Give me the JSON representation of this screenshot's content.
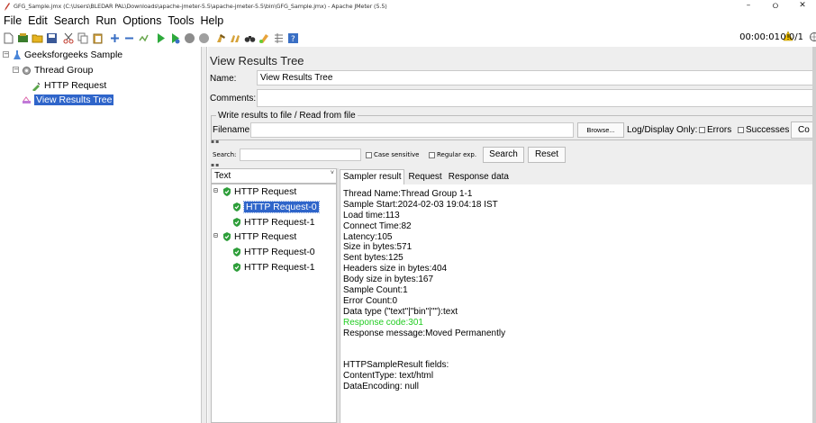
{
  "window": {
    "title": "GFG_Sample.jmx (C:\\Users\\BLEDAR PAL\\Downloads\\apache-jmeter-5.5\\apache-jmeter-5.5\\bin\\GFG_Sample.jmx) - Apache JMeter (5.5)",
    "minimize": "–",
    "maximize": "⭘",
    "close": "✕"
  },
  "menu": [
    "File",
    "Edit",
    "Search",
    "Run",
    "Options",
    "Tools",
    "Help"
  ],
  "toolbar": {
    "timer": "00:00:01",
    "warnings": "0",
    "threads": "0/1"
  },
  "tree": {
    "root": "Geeksforgeeks Sample",
    "thread_group": "Thread Group",
    "http_request": "HTTP Request",
    "listener": "View Results Tree"
  },
  "panel": {
    "title": "View Results Tree",
    "name_label": "Name:",
    "name_value": "View Results Tree",
    "comments_label": "Comments:",
    "file_legend": "Write results to file / Read from file",
    "filename_label": "Filename",
    "browse_label": "Browse...",
    "log_display": "Log/Display Only:",
    "errors_label": "Errors",
    "successes_label": "Successes",
    "configure_label": "Co",
    "search_label": "Search:",
    "case_sensitive": "Case sensitive",
    "regular_exp": "Regular exp.",
    "search_button": "Search",
    "reset_button": "Reset"
  },
  "results": {
    "renderer": "Text",
    "samples": [
      {
        "label": "HTTP Request",
        "children": [
          "HTTP Request-0",
          "HTTP Request-1"
        ]
      },
      {
        "label": "HTTP Request",
        "children": [
          "HTTP Request-0",
          "HTTP Request-1"
        ]
      }
    ],
    "tabs": [
      "Sampler result",
      "Request",
      "Response data"
    ],
    "sampler_result": [
      "Thread Name:Thread Group 1-1",
      "Sample Start:2024-02-03 19:04:18 IST",
      "Load time:113",
      "Connect Time:82",
      "Latency:105",
      "Size in bytes:571",
      "Sent bytes:125",
      "Headers size in bytes:404",
      "Body size in bytes:167",
      "Sample Count:1",
      "Error Count:0",
      "Data type (\"text\"|\"bin\"|\"\"):text",
      "Response code:301",
      "Response message:Moved Permanently",
      "",
      "",
      "HTTPSampleResult fields:",
      "ContentType: text/html",
      "DataEncoding: null"
    ],
    "highlight_color": "#22cc22",
    "selection_color": "#2f65ca"
  }
}
